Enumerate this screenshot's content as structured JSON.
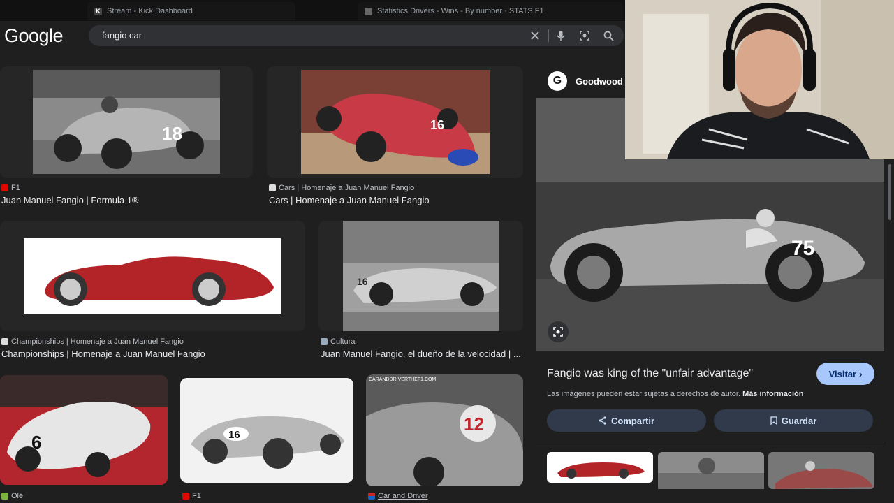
{
  "tabs": [
    {
      "label": "Stream - Kick Dashboard",
      "icon": "kick-icon"
    },
    {
      "label": "Statistics Drivers - Wins - By number · STATS F1",
      "icon": "stats-icon"
    }
  ],
  "google": {
    "logo": "Google"
  },
  "search": {
    "query": "fangio car"
  },
  "results": [
    {
      "source": "F1",
      "title": "Juan Manuel Fangio | Formula 1®"
    },
    {
      "source": "Cars | Homenaje a Juan Manuel Fangio",
      "title": "Cars | Homenaje a Juan Manuel Fangio"
    },
    {
      "source": "Championships | Homenaje a Juan Manuel Fangio",
      "title": "Championships | Homenaje a Juan Manuel Fangio"
    },
    {
      "source": "Cultura",
      "title": "Juan Manuel Fangio, el dueño de la velocidad | ..."
    },
    {
      "source": "Olé",
      "title": ""
    },
    {
      "source": "F1",
      "title": ""
    },
    {
      "source": "Car and Driver",
      "title": ""
    }
  ],
  "panel": {
    "site": "Goodwood",
    "site_logo_letter": "G",
    "title": "Fangio was king of the \"unfair advantage\"",
    "visit": "Visitar",
    "copyright": "Las imágenes pueden estar sujetas a derechos de autor.",
    "more_info": "Más información",
    "share": "Compartir",
    "save": "Guardar",
    "car_number": "75"
  },
  "image_labels": {
    "r1": "18",
    "r2": "16",
    "r4": "16",
    "r5": "6",
    "r6": "16",
    "r7": "12",
    "r7_watermark": "CARANDDRIVERTHEF1.COM"
  }
}
